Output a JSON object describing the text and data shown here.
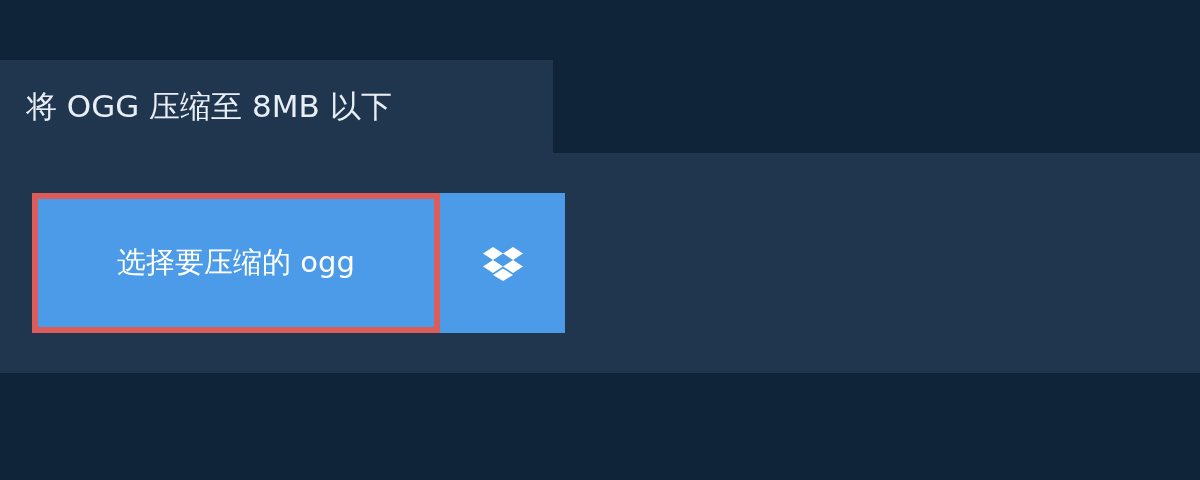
{
  "tab": {
    "title": "将 OGG 压缩至 8MB 以下"
  },
  "upload": {
    "button": "选择要压缩的 ogg",
    "focused": true
  }
}
